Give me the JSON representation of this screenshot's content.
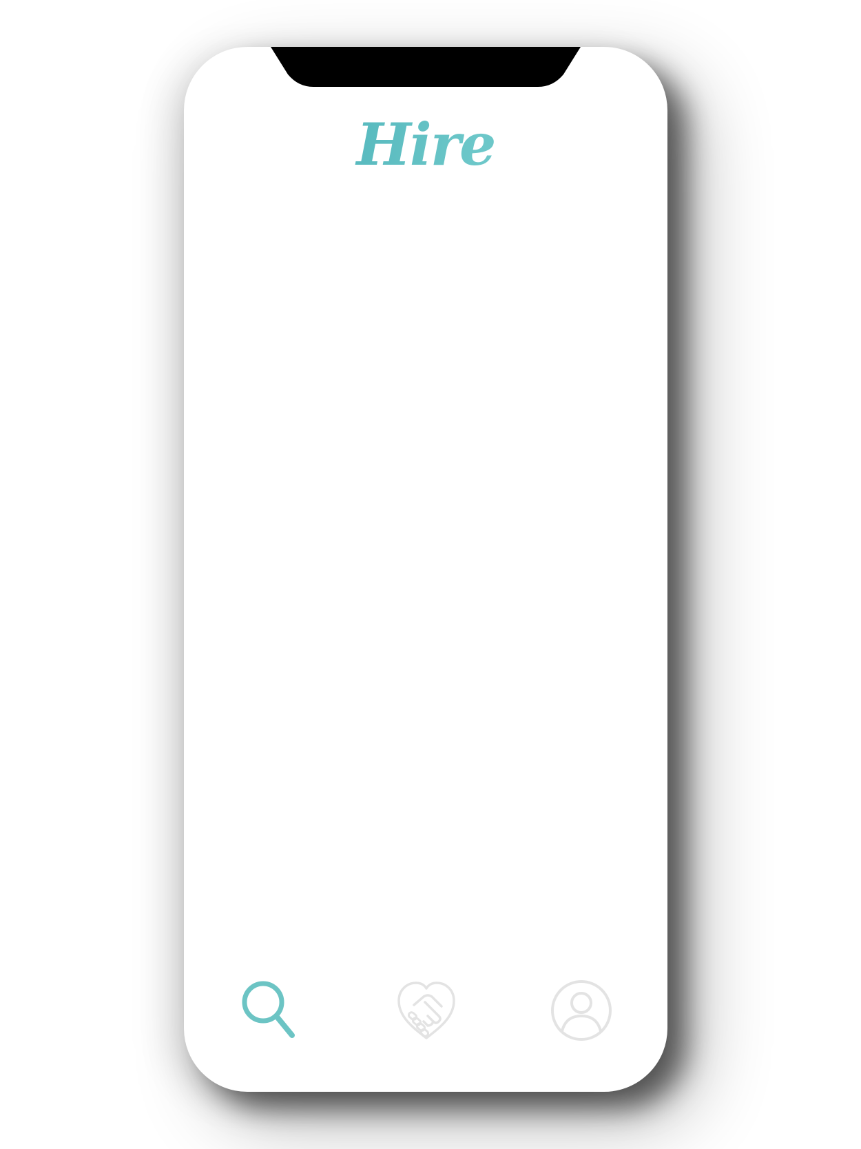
{
  "app": {
    "logo_text": "Hire"
  },
  "theme": {
    "accent_color": "#6cc4c4",
    "inactive_icon_color": "#e3e3e3",
    "notch_color": "#000000",
    "screen_background": "#ffffff"
  },
  "tabbar": {
    "active_tab": "search",
    "tabs": [
      {
        "id": "search",
        "icon": "search-icon",
        "active": true
      },
      {
        "id": "matches",
        "icon": "handshake-heart-icon",
        "active": false
      },
      {
        "id": "profile",
        "icon": "user-profile-icon",
        "active": false
      }
    ]
  }
}
